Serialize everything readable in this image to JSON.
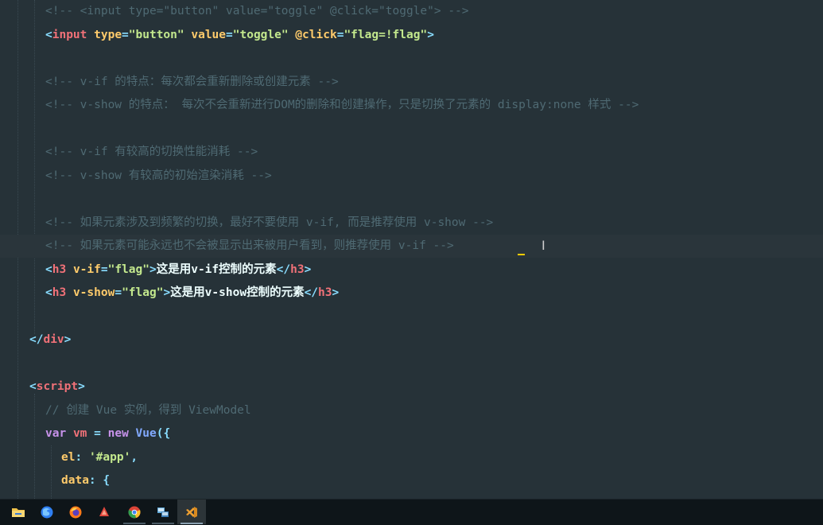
{
  "editor": {
    "lines": [
      {
        "tokens": [
          {
            "t": "<!-- <input type=\"button\" value=\"toggle\" @click=\"toggle\"> -->",
            "c": "cm"
          }
        ]
      },
      {
        "tokens": [
          {
            "t": "<",
            "c": "pn"
          },
          {
            "t": "input",
            "c": "tg"
          },
          {
            "t": " ",
            "c": "tx"
          },
          {
            "t": "type",
            "c": "at"
          },
          {
            "t": "=",
            "c": "pn"
          },
          {
            "t": "\"button\"",
            "c": "st"
          },
          {
            "t": " ",
            "c": "tx"
          },
          {
            "t": "value",
            "c": "at"
          },
          {
            "t": "=",
            "c": "pn"
          },
          {
            "t": "\"toggle\"",
            "c": "st"
          },
          {
            "t": " ",
            "c": "tx"
          },
          {
            "t": "@click",
            "c": "at"
          },
          {
            "t": "=",
            "c": "pn"
          },
          {
            "t": "\"flag=!flag\"",
            "c": "st"
          },
          {
            "t": ">",
            "c": "pn"
          }
        ]
      },
      {
        "tokens": []
      },
      {
        "tokens": [
          {
            "t": "<!-- v-if 的特点：每次都会重新删除或创建元素 -->",
            "c": "cm"
          }
        ]
      },
      {
        "tokens": [
          {
            "t": "<!-- v-show 的特点： 每次不会重新进行DOM的删除和创建操作，只是切换了元素的 display:none 样式 -->",
            "c": "cm"
          }
        ]
      },
      {
        "tokens": []
      },
      {
        "tokens": [
          {
            "t": "<!-- v-if 有较高的切换性能消耗 -->",
            "c": "cm"
          }
        ]
      },
      {
        "tokens": [
          {
            "t": "<!-- v-show 有较高的初始渲染消耗 -->",
            "c": "cm"
          }
        ]
      },
      {
        "tokens": []
      },
      {
        "tokens": [
          {
            "t": "<!-- 如果元素涉及到频繁的切换，最好不要使用 v-if, 而是推荐使用 v-show -->",
            "c": "cm"
          }
        ]
      },
      {
        "tokens": [
          {
            "t": "<!-- 如果元素可能永远也不会被显示出来被用户看到，则推荐使用 v-if -->",
            "c": "cm"
          }
        ]
      },
      {
        "tokens": [
          {
            "t": "<",
            "c": "pn"
          },
          {
            "t": "h3",
            "c": "tg"
          },
          {
            "t": " ",
            "c": "tx"
          },
          {
            "t": "v-if",
            "c": "at"
          },
          {
            "t": "=",
            "c": "pn"
          },
          {
            "t": "\"flag\"",
            "c": "st"
          },
          {
            "t": ">",
            "c": "pn"
          },
          {
            "t": "这是用v-if控制的元素",
            "c": "tx"
          },
          {
            "t": "</",
            "c": "pn"
          },
          {
            "t": "h3",
            "c": "tg"
          },
          {
            "t": ">",
            "c": "pn"
          }
        ]
      },
      {
        "tokens": [
          {
            "t": "<",
            "c": "pn"
          },
          {
            "t": "h3",
            "c": "tg"
          },
          {
            "t": " ",
            "c": "tx"
          },
          {
            "t": "v-show",
            "c": "at"
          },
          {
            "t": "=",
            "c": "pn"
          },
          {
            "t": "\"flag\"",
            "c": "st"
          },
          {
            "t": ">",
            "c": "pn"
          },
          {
            "t": "这是用v-show控制的元素",
            "c": "tx"
          },
          {
            "t": "</",
            "c": "pn"
          },
          {
            "t": "h3",
            "c": "tg"
          },
          {
            "t": ">",
            "c": "pn"
          }
        ]
      },
      {
        "tokens": []
      },
      {
        "tokens": [
          {
            "t": "</",
            "c": "pn"
          },
          {
            "t": "div",
            "c": "tg"
          },
          {
            "t": ">",
            "c": "pn"
          }
        ]
      },
      {
        "tokens": []
      },
      {
        "tokens": [
          {
            "t": "<",
            "c": "pn"
          },
          {
            "t": "script",
            "c": "tg"
          },
          {
            "t": ">",
            "c": "pn"
          }
        ]
      },
      {
        "tokens": [
          {
            "t": "// 创建 Vue 实例，得到 ViewModel",
            "c": "cm"
          }
        ]
      },
      {
        "tokens": [
          {
            "t": "var",
            "c": "kw"
          },
          {
            "t": " ",
            "c": "tx"
          },
          {
            "t": "vm",
            "c": "tg"
          },
          {
            "t": " ",
            "c": "tx"
          },
          {
            "t": "=",
            "c": "pn"
          },
          {
            "t": " ",
            "c": "tx"
          },
          {
            "t": "new",
            "c": "kw"
          },
          {
            "t": " ",
            "c": "tx"
          },
          {
            "t": "Vue",
            "c": "fn"
          },
          {
            "t": "({",
            "c": "pn"
          }
        ]
      },
      {
        "tokens": [
          {
            "t": "el",
            "c": "at"
          },
          {
            "t": ":",
            "c": "pn"
          },
          {
            "t": " ",
            "c": "tx"
          },
          {
            "t": "'#app'",
            "c": "st"
          },
          {
            "t": ",",
            "c": "pn"
          }
        ]
      },
      {
        "tokens": [
          {
            "t": "data",
            "c": "at"
          },
          {
            "t": ":",
            "c": "pn"
          },
          {
            "t": " ",
            "c": "tx"
          },
          {
            "t": "{",
            "c": "pn"
          }
        ]
      }
    ]
  },
  "taskbar": {
    "apps": [
      {
        "name": "file-explorer",
        "icon": "folder-icon",
        "color": "#f0c24b"
      },
      {
        "name": "firefox-dev",
        "icon": "firefox-dev-icon",
        "color": "#2f7ff2"
      },
      {
        "name": "firefox",
        "icon": "firefox-icon",
        "color": "#ff7a1a"
      },
      {
        "name": "app-red",
        "icon": "red-app-icon",
        "color": "#e0473c"
      },
      {
        "name": "chrome",
        "icon": "chrome-icon",
        "color": "#db4437"
      },
      {
        "name": "remote-tool",
        "icon": "network-icon",
        "color": "#5fa8d8"
      },
      {
        "name": "vscode",
        "icon": "vscode-icon",
        "color": "#f0a030"
      }
    ]
  }
}
